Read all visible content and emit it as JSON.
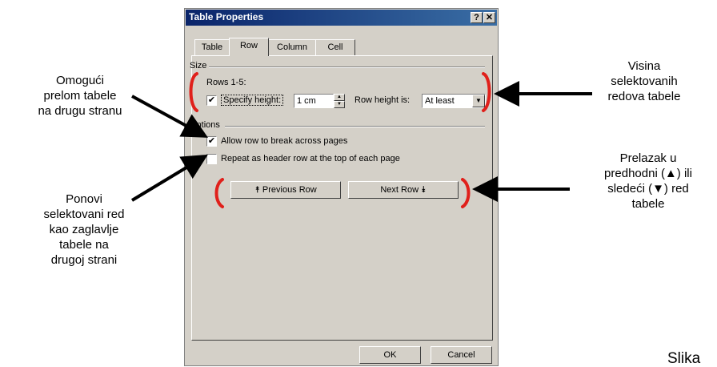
{
  "dialog": {
    "title": "Table Properties",
    "help_glyph": "?",
    "close_glyph": "✕",
    "tabs": [
      "Table",
      "Row",
      "Column",
      "Cell"
    ],
    "active_tab": "Row",
    "size_section": "Size",
    "rows_label": "Rows 1-5:",
    "specify_height_label": "Specify height:",
    "specify_height_checked": true,
    "height_value": "1 cm",
    "row_height_is_label": "Row height is:",
    "row_height_is_value": "At least",
    "options_section": "Options",
    "allow_break_label": "Allow row to break across pages",
    "allow_break_checked": true,
    "repeat_header_label": "Repeat as header row at the top of each page",
    "repeat_header_checked": false,
    "prev_row_label": "⯭ Previous Row",
    "next_row_label": "Next Row ⯯",
    "ok_label": "OK",
    "cancel_label": "Cancel",
    "check_glyph": "✔"
  },
  "callouts": {
    "break_pages": [
      "Omogući",
      "prelom tabele",
      "na drugu stranu"
    ],
    "repeat_header": [
      "Ponovi",
      "selektovani red",
      "kao zaglavlje",
      "tabele na",
      "drugoj strani"
    ],
    "row_height": [
      "Visina",
      "selektovanih",
      "redova tabele"
    ],
    "prev_next": [
      "Prelazak u",
      "predhodni (▲) ili",
      "sledeći (▼) red",
      "tabele"
    ]
  },
  "caption": "Slika",
  "colors": {
    "bracket": "#e0201b",
    "titlebar": "#0a246a",
    "dialog_bg": "#d4d0c8"
  }
}
